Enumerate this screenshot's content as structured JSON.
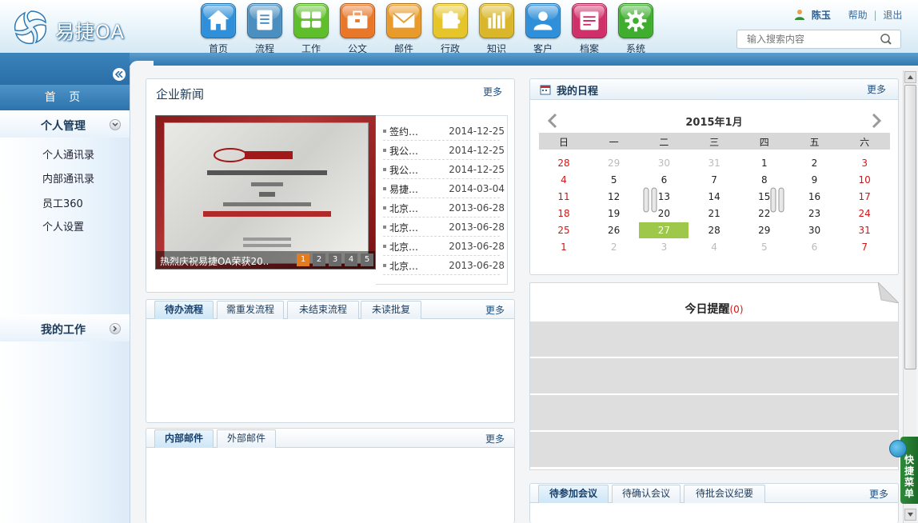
{
  "app": {
    "logo_text": "易捷OA"
  },
  "nav": [
    {
      "label": "首页",
      "icon": "home-icon",
      "color": "#2f8fd8"
    },
    {
      "label": "流程",
      "icon": "flow-icon",
      "color": "#4a8fbf"
    },
    {
      "label": "工作",
      "icon": "work-icon",
      "color": "#5fbf2a"
    },
    {
      "label": "公文",
      "icon": "briefcase-icon",
      "color": "#e8772a"
    },
    {
      "label": "邮件",
      "icon": "mail-icon",
      "color": "#e89a2a"
    },
    {
      "label": "行政",
      "icon": "puzzle-icon",
      "color": "#e6c52a"
    },
    {
      "label": "知识",
      "icon": "knowledge-icon",
      "color": "#d9b62a"
    },
    {
      "label": "客户",
      "icon": "customer-icon",
      "color": "#2f8fd8"
    },
    {
      "label": "档案",
      "icon": "archive-icon",
      "color": "#d0306a"
    },
    {
      "label": "系统",
      "icon": "gear-icon",
      "color": "#3fae2f"
    }
  ],
  "user": {
    "name": "陈玉",
    "help": "帮助",
    "sep": "|",
    "logout": "退出"
  },
  "search": {
    "placeholder": "输入搜索内容"
  },
  "sidebar": {
    "home": "首 页",
    "personal": {
      "title": "个人管理",
      "items": [
        "个人通讯录",
        "内部通讯录",
        "员工360",
        "个人设置"
      ]
    },
    "work": {
      "title": "我的工作"
    }
  },
  "news": {
    "title": "企业新闻",
    "more": "更多",
    "caption": "热烈庆祝易捷OA荣获20..",
    "pages": [
      "1",
      "2",
      "3",
      "4",
      "5"
    ],
    "items": [
      {
        "title": "签约…",
        "date": "2014-12-25"
      },
      {
        "title": "我公…",
        "date": "2014-12-25"
      },
      {
        "title": "我公…",
        "date": "2014-12-25"
      },
      {
        "title": "易捷…",
        "date": "2014-03-04"
      },
      {
        "title": "北京…",
        "date": "2013-06-28"
      },
      {
        "title": "北京…",
        "date": "2013-06-28"
      },
      {
        "title": "北京…",
        "date": "2013-06-28"
      },
      {
        "title": "北京…",
        "date": "2013-06-28"
      }
    ]
  },
  "flow_panel": {
    "tabs": [
      "待办流程",
      "需重发流程",
      "未结束流程",
      "未读批复"
    ],
    "more": "更多"
  },
  "mail_panel": {
    "tabs": [
      "内部邮件",
      "外部邮件"
    ],
    "more": "更多"
  },
  "schedule": {
    "title": "我的日程",
    "more": "更多",
    "month": "2015年1月",
    "weekdays": [
      "日",
      "一",
      "二",
      "三",
      "四",
      "五",
      "六"
    ],
    "weeks": [
      [
        "28",
        "29",
        "30",
        "31",
        "1",
        "2",
        "3"
      ],
      [
        "4",
        "5",
        "6",
        "7",
        "8",
        "9",
        "10"
      ],
      [
        "11",
        "12",
        "13",
        "14",
        "15",
        "16",
        "17"
      ],
      [
        "18",
        "19",
        "20",
        "21",
        "22",
        "23",
        "24"
      ],
      [
        "25",
        "26",
        "27",
        "28",
        "29",
        "30",
        "31"
      ],
      [
        "1",
        "2",
        "3",
        "4",
        "5",
        "6",
        "7"
      ]
    ],
    "selected": "27"
  },
  "reminder": {
    "title": "今日提醒",
    "count": "(0)"
  },
  "meeting_panel": {
    "tabs": [
      "待参加会议",
      "待确认会议",
      "待批会议纪要"
    ],
    "more": "更多"
  },
  "quick_menu": {
    "label": "快捷菜单"
  }
}
